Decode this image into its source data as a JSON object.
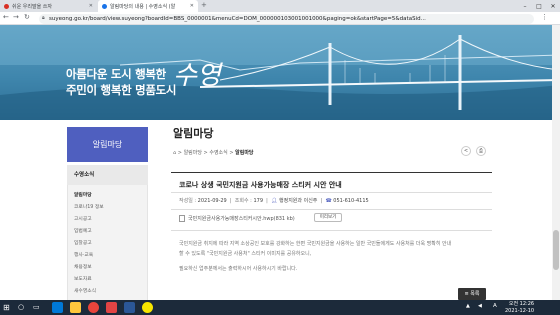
{
  "browser": {
    "tabs": [
      {
        "label": "쉬운 우리말을 쓰자"
      },
      {
        "label": "알림마당의 내용 | 수영소식 (알"
      }
    ],
    "new_tab": "+",
    "url": "suyeong.go.kr/board/view.suyeong?boardId=BBS_0000001&menuCd=DOM_000000103001001000&paging=ok&startPage=5&dataSid..."
  },
  "banner": {
    "line1": "아름다운 도시 행복한",
    "line2": "주민이 행복한 명품도시",
    "logo": "수영"
  },
  "sidebar": {
    "title": "알림마당",
    "section": "수영소식",
    "items": [
      {
        "label": "알림마당",
        "active": true
      },
      {
        "label": "코로나19 정보"
      },
      {
        "label": "고시공고"
      },
      {
        "label": "입법예고"
      },
      {
        "label": "입찰공고"
      },
      {
        "label": "행사·교육"
      },
      {
        "label": "채용정보"
      },
      {
        "label": "보도자료"
      },
      {
        "label": "새수영소식"
      },
      {
        "label": "정부 정책 안내"
      }
    ]
  },
  "content": {
    "page_title": "알림마당",
    "breadcrumb": [
      "알림마당",
      "수영소식",
      "알림마당"
    ],
    "post_title": "코로나 상생 국민지원금 사용가능매장 스티커 시안 안내",
    "meta": {
      "date_label": "작성일 :",
      "date": "2021-09-29",
      "views_label": "조회수 :",
      "views": "179",
      "author": "행정지원과 이신주",
      "phone": "051-610-4115"
    },
    "attachment": "국민지원금사용가능매장스티커시안.hwp(831 kb)",
    "preview_label": "미리보기",
    "body": [
      "국민지원금 취지에 따라 지역 소상공인 보호를 강화하는 한편 국민지원금을 사용하는 일반 국민들에게도 사용처를 더욱 명확히 안내",
      "할 수 있도록 \"국민지원금 사용처\" 스티커 이미지를 공유하오니,",
      "필요하신 업주분께서는 출력하시어 사용하시기 바랍니다."
    ],
    "list_button": "목록"
  },
  "taskbar": {
    "lang": "A",
    "time_period": "오전 12:26",
    "date": "2021-12-10"
  },
  "colors": {
    "accent": "#4f5fbf",
    "banner": "#3f86ad",
    "taskbar": "#1c2a3a"
  }
}
